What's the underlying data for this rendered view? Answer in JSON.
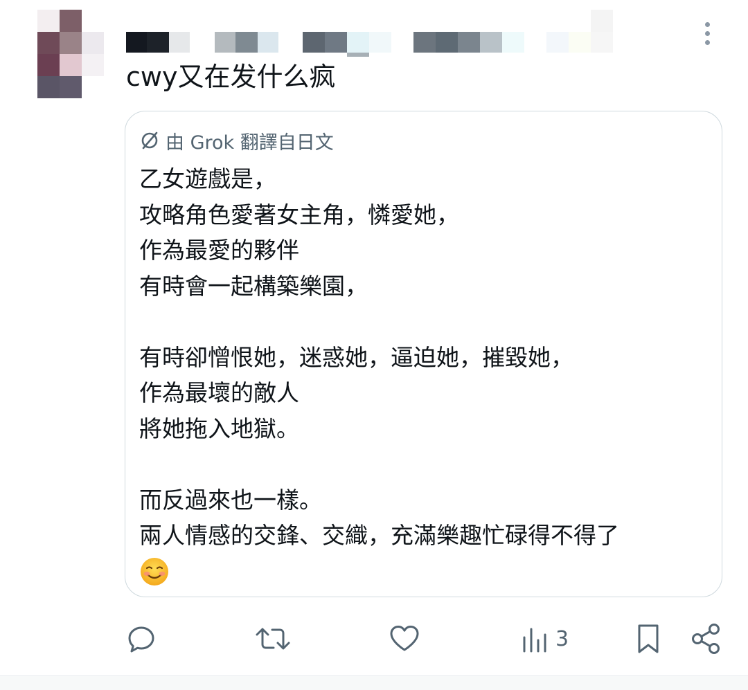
{
  "post": {
    "text": "cwy又在发什么疯"
  },
  "translation": {
    "note": "由 Grok 翻譯自日文",
    "icon": "grok-icon",
    "lines": [
      "乙女遊戲是，",
      "攻略角色愛著女主角，憐愛她，",
      "作為最愛的夥伴",
      "有時會一起構築樂園，",
      "",
      "有時卻憎恨她，迷惑她，逼迫她，摧毀她，",
      "作為最壞的敵人",
      "將她拖入地獄。",
      "",
      "而反過來也一樣。",
      "兩人情感的交鋒、交織，充滿樂趣忙碌得不得了"
    ],
    "emoji": "smiling-face-icon"
  },
  "actions": {
    "reply_icon": "reply-icon",
    "repost_icon": "repost-icon",
    "like_icon": "heart-icon",
    "views_icon": "views-icon",
    "views_count": "3",
    "bookmark_icon": "bookmark-icon",
    "share_icon": "share-icon"
  },
  "colors": {
    "text": "#0f1419",
    "muted": "#536471",
    "border": "#cfd9de"
  }
}
